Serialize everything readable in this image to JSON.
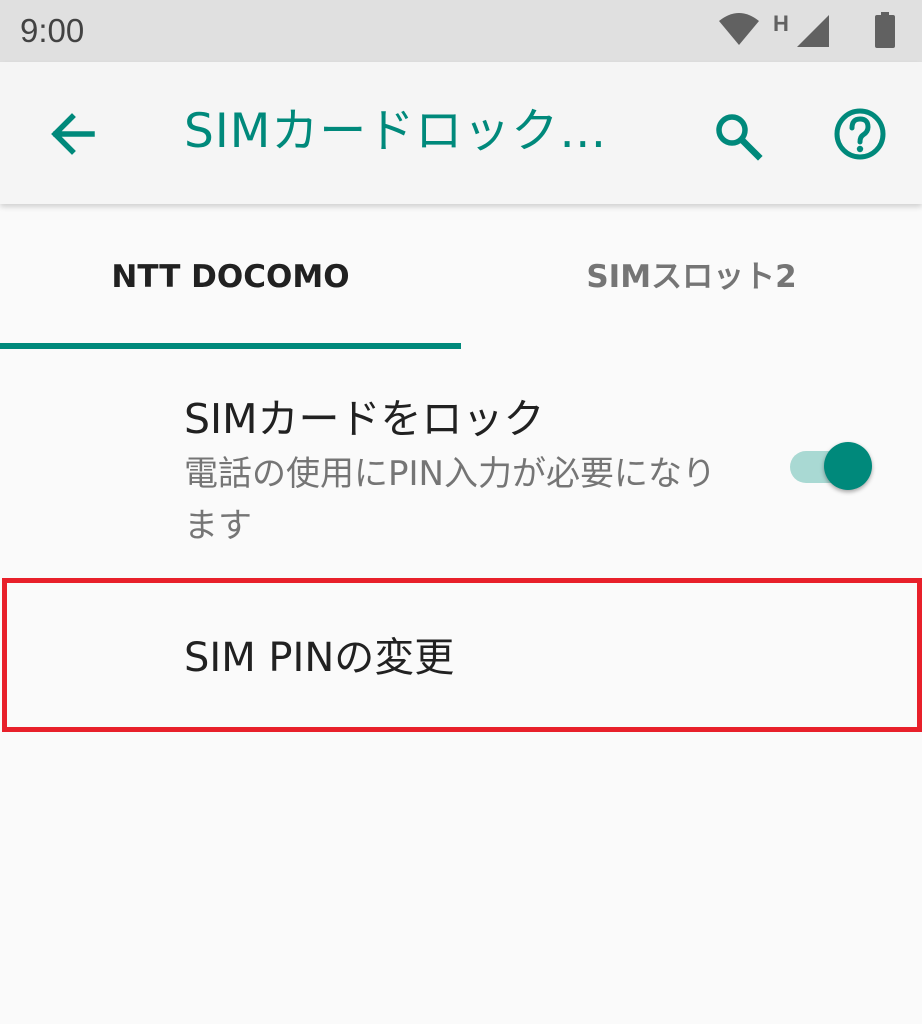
{
  "status_bar": {
    "time": "9:00",
    "network_type": "H",
    "icons": [
      "wifi-icon",
      "network-type-icon",
      "cellular-signal-icon",
      "battery-icon"
    ]
  },
  "app_bar": {
    "title": "SIMカードロック…",
    "back_icon": "arrow-back-icon",
    "search_icon": "search-icon",
    "help_icon": "help-circle-icon"
  },
  "tabs": [
    {
      "label": "NTT DOCOMO",
      "selected": true
    },
    {
      "label": "SIMスロット2",
      "selected": false
    }
  ],
  "preferences": {
    "lock_sim": {
      "title": "SIMカードをロック",
      "summary": "電話の使用にPIN入力が必要になります",
      "toggle_on": true
    },
    "change_pin": {
      "title": "SIM PINの変更",
      "highlighted": true
    }
  },
  "colors": {
    "accent": "#00897b",
    "highlight_border": "#e8202a",
    "status_bar_bg": "#e0e0e0",
    "app_bar_bg": "#f5f5f5"
  }
}
